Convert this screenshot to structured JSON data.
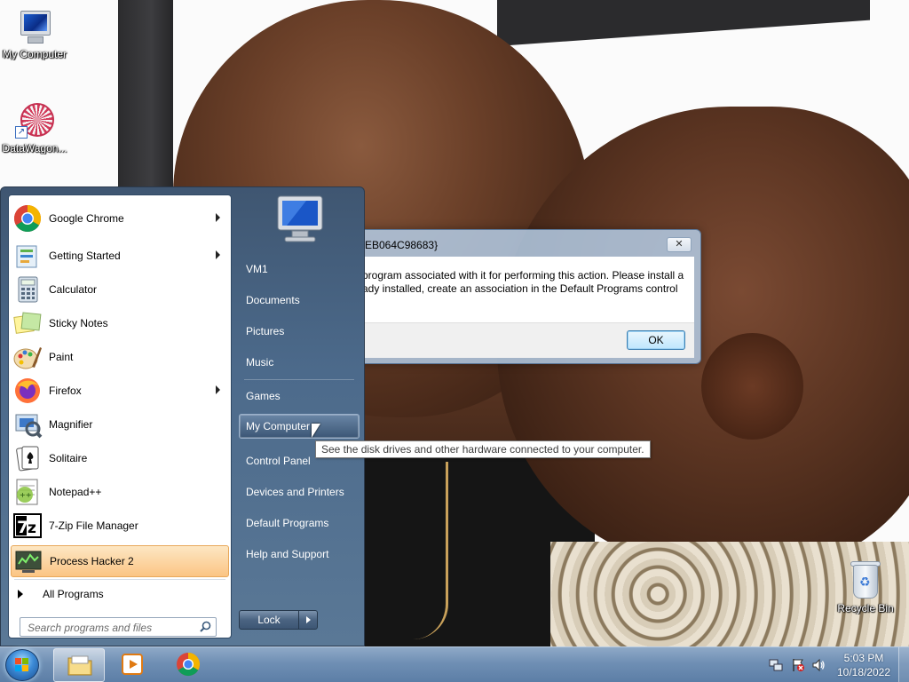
{
  "desktop": {
    "icons": [
      {
        "label": "My Computer",
        "icon": "computer-icon"
      },
      {
        "label": "DataWagon...",
        "icon": "datawagon-icon"
      },
      {
        "label": "Recycle Bin",
        "icon": "recycle-bin-icon"
      }
    ]
  },
  "dialog": {
    "title_fragment": "EB064C98683}",
    "message_line1": "program associated with it for performing this action. Please install a",
    "message_line2": "ady installed, create an association in the Default Programs control",
    "ok_label": "OK",
    "close_glyph": "✕"
  },
  "start_menu": {
    "pinned": [
      {
        "label": "Google Chrome",
        "icon": "chrome-icon",
        "has_submenu": true
      },
      {
        "label": "Getting Started",
        "icon": "getting-started-icon",
        "has_submenu": true
      },
      {
        "label": "Calculator",
        "icon": "calculator-icon",
        "has_submenu": false
      },
      {
        "label": "Sticky Notes",
        "icon": "sticky-notes-icon",
        "has_submenu": false
      },
      {
        "label": "Paint",
        "icon": "paint-icon",
        "has_submenu": false
      },
      {
        "label": "Firefox",
        "icon": "firefox-icon",
        "has_submenu": true
      },
      {
        "label": "Magnifier",
        "icon": "magnifier-icon",
        "has_submenu": false
      },
      {
        "label": "Solitaire",
        "icon": "solitaire-icon",
        "has_submenu": false
      },
      {
        "label": "Notepad++",
        "icon": "notepadpp-icon",
        "has_submenu": false
      },
      {
        "label": "7-Zip File Manager",
        "icon": "7zip-icon",
        "has_submenu": false
      },
      {
        "label": "Process Hacker 2",
        "icon": "process-hacker-icon",
        "has_submenu": false,
        "highlighted": true
      }
    ],
    "all_programs_label": "All Programs",
    "search_placeholder": "Search programs and files",
    "right_links": [
      {
        "label": "VM1"
      },
      {
        "label": "Documents"
      },
      {
        "label": "Pictures"
      },
      {
        "label": "Music"
      },
      {
        "label": "Games"
      },
      {
        "label": "My Computer",
        "highlighted": true
      },
      {
        "label": "Control Panel"
      },
      {
        "label": "Devices and Printers"
      },
      {
        "label": "Default Programs"
      },
      {
        "label": "Help and Support"
      }
    ],
    "lock_label": "Lock",
    "tooltip": "See the disk drives and other hardware connected to your computer."
  },
  "taskbar": {
    "buttons": [
      {
        "icon": "explorer-icon",
        "active": true
      },
      {
        "icon": "media-player-icon",
        "active": false
      },
      {
        "icon": "chrome-icon",
        "active": false
      }
    ],
    "tray_icons": [
      "network-icon",
      "action-center-flag-icon",
      "volume-icon"
    ],
    "time": "5:03 PM",
    "date": "10/18/2022"
  },
  "colors": {
    "highlight_orange": "#fbc584",
    "start_menu_blue": "#4c6a8b",
    "taskbar_blue": "#6f8fb4"
  }
}
